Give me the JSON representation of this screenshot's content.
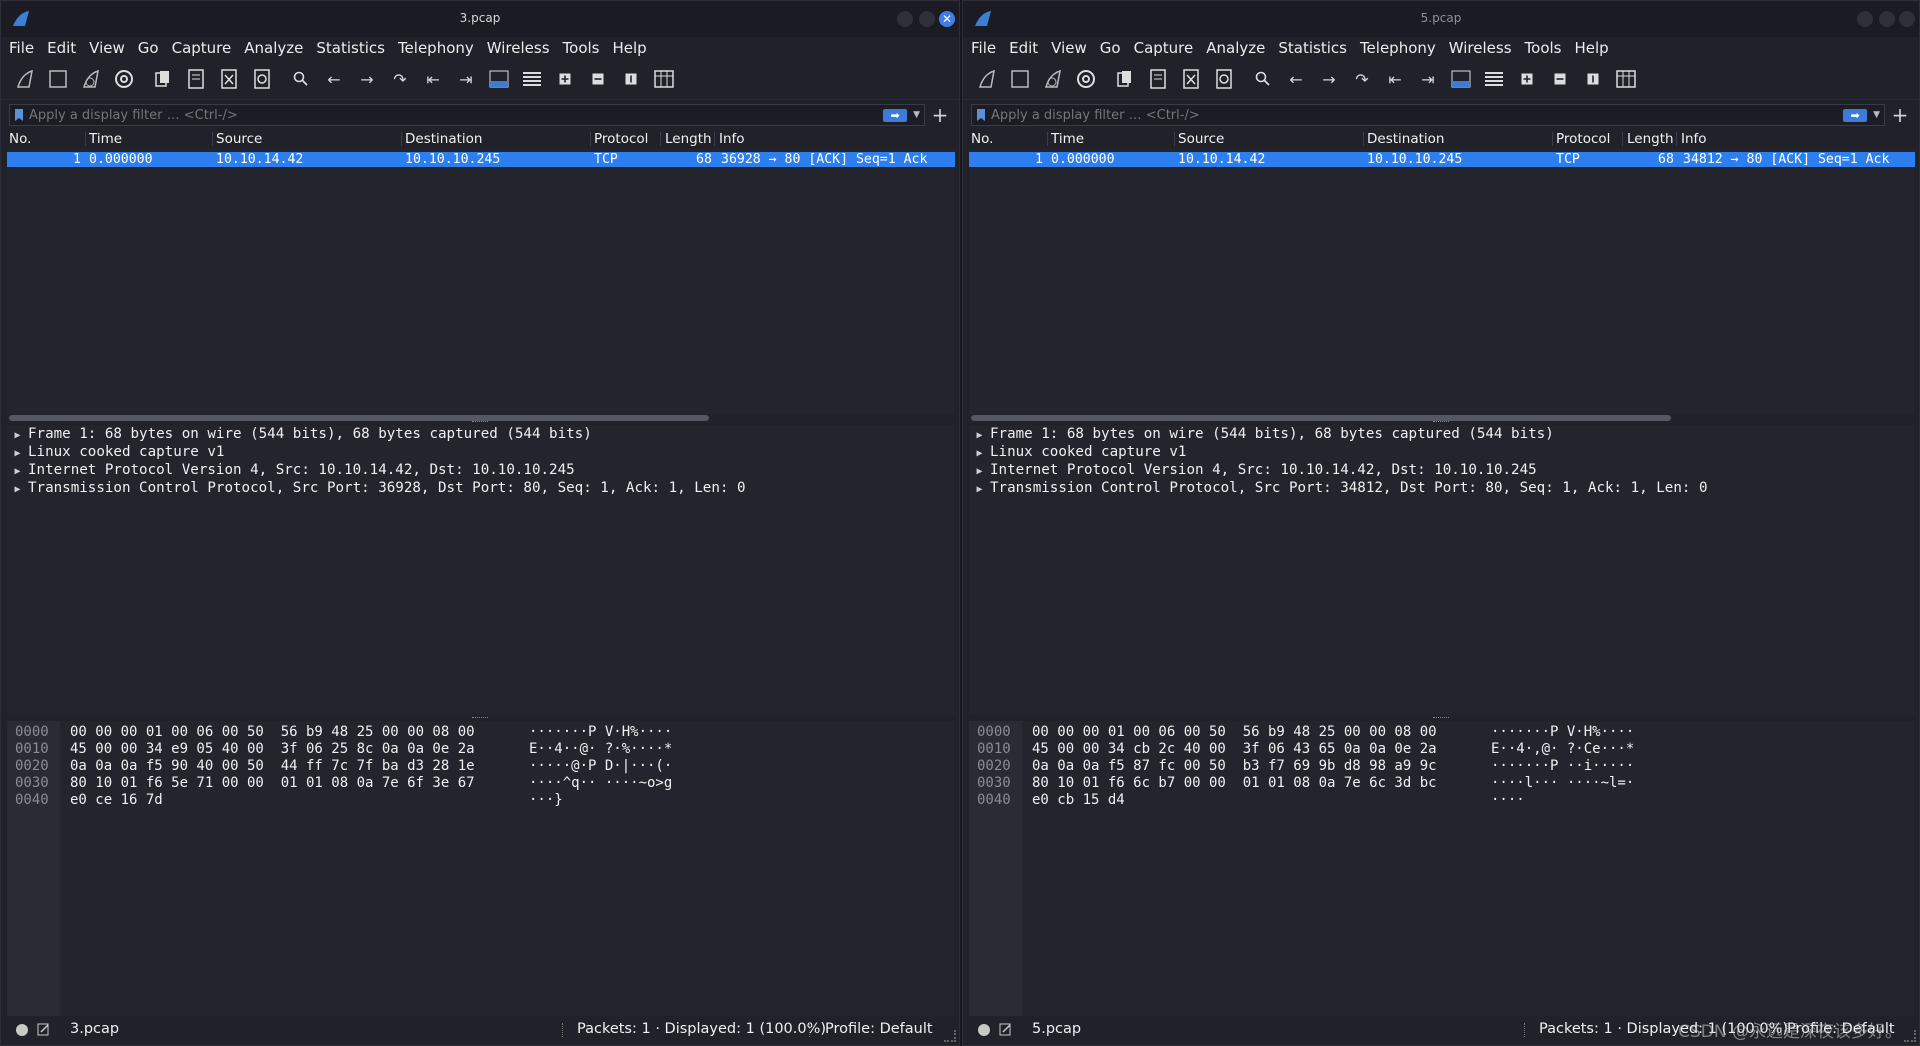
{
  "menu": [
    "File",
    "Edit",
    "View",
    "Go",
    "Capture",
    "Analyze",
    "Statistics",
    "Telephony",
    "Wireless",
    "Tools",
    "Help"
  ],
  "filter_placeholder": "Apply a display filter … <Ctrl-/>",
  "columns": {
    "no": "No.",
    "time": "Time",
    "source": "Source",
    "destination": "Destination",
    "protocol": "Protocol",
    "length": "Length",
    "info": "Info"
  },
  "colors": {
    "accent": "#2d7ff0",
    "window_bg": "#202129",
    "pane_bg": "#23242c",
    "text": "#f0f0f0"
  },
  "watermark": "CSDN @永远是深夜该多好。",
  "windows": [
    {
      "title": "3.pcap",
      "packet": {
        "no": "1",
        "time": "0.000000",
        "source": "10.10.14.42",
        "destination": "10.10.10.245",
        "protocol": "TCP",
        "length": "68",
        "info": "36928 → 80 [ACK] Seq=1 Ack"
      },
      "details": [
        "Frame 1: 68 bytes on wire (544 bits), 68 bytes captured (544 bits)",
        "Linux cooked capture v1",
        "Internet Protocol Version 4, Src: 10.10.14.42, Dst: 10.10.10.245",
        "Transmission Control Protocol, Src Port: 36928, Dst Port: 80, Seq: 1, Ack: 1, Len: 0"
      ],
      "bytes": [
        {
          "off": "0000",
          "hex": "00 00 00 01 00 06 00 50  56 b9 48 25 00 00 08 00",
          "ascii": "·······P V·H%····"
        },
        {
          "off": "0010",
          "hex": "45 00 00 34 e9 05 40 00  3f 06 25 8c 0a 0a 0e 2a",
          "ascii": "E··4··@· ?·%····*"
        },
        {
          "off": "0020",
          "hex": "0a 0a 0a f5 90 40 00 50  44 ff 7c 7f ba d3 28 1e",
          "ascii": "·····@·P D·|···(·"
        },
        {
          "off": "0030",
          "hex": "80 10 01 f6 5e 71 00 00  01 01 08 0a 7e 6f 3e 67",
          "ascii": "····^q·· ····~o>g"
        },
        {
          "off": "0040",
          "hex": "e0 ce 16 7d",
          "ascii": "···}"
        }
      ],
      "status": {
        "file": "3.pcap",
        "packets": "Packets: 1 · Displayed: 1 (100.0%)",
        "profile": "Profile: Default"
      }
    },
    {
      "title": "5.pcap",
      "packet": {
        "no": "1",
        "time": "0.000000",
        "source": "10.10.14.42",
        "destination": "10.10.10.245",
        "protocol": "TCP",
        "length": "68",
        "info": "34812 → 80 [ACK] Seq=1 Ack"
      },
      "details": [
        "Frame 1: 68 bytes on wire (544 bits), 68 bytes captured (544 bits)",
        "Linux cooked capture v1",
        "Internet Protocol Version 4, Src: 10.10.14.42, Dst: 10.10.10.245",
        "Transmission Control Protocol, Src Port: 34812, Dst Port: 80, Seq: 1, Ack: 1, Len: 0"
      ],
      "bytes": [
        {
          "off": "0000",
          "hex": "00 00 00 01 00 06 00 50  56 b9 48 25 00 00 08 00",
          "ascii": "·······P V·H%····"
        },
        {
          "off": "0010",
          "hex": "45 00 00 34 cb 2c 40 00  3f 06 43 65 0a 0a 0e 2a",
          "ascii": "E··4·,@· ?·Ce···*"
        },
        {
          "off": "0020",
          "hex": "0a 0a 0a f5 87 fc 00 50  b3 f7 69 9b d8 98 a9 9c",
          "ascii": "·······P ··i·····"
        },
        {
          "off": "0030",
          "hex": "80 10 01 f6 6c b7 00 00  01 01 08 0a 7e 6c 3d bc",
          "ascii": "····l··· ····~l=·"
        },
        {
          "off": "0040",
          "hex": "e0 cb 15 d4",
          "ascii": "····"
        }
      ],
      "status": {
        "file": "5.pcap",
        "packets": "Packets: 1 · Displayed: 1 (100.0%)",
        "profile": "Profile: Default"
      }
    }
  ]
}
